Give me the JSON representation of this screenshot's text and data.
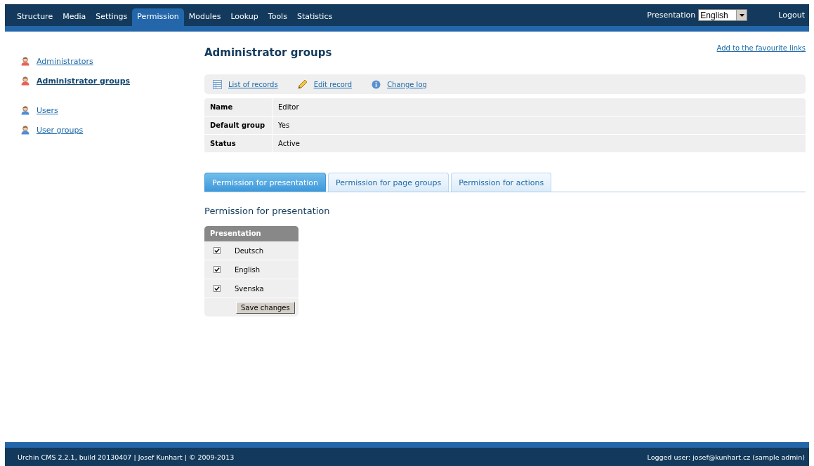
{
  "menu": [
    {
      "label": "Structure",
      "selected": false
    },
    {
      "label": "Media",
      "selected": false
    },
    {
      "label": "Settings",
      "selected": false
    },
    {
      "label": "Permission",
      "selected": true
    },
    {
      "label": "Modules",
      "selected": false
    },
    {
      "label": "Lookup",
      "selected": false
    },
    {
      "label": "Tools",
      "selected": false
    },
    {
      "label": "Statistics",
      "selected": false
    }
  ],
  "presentation": {
    "label": "Presentation",
    "value": "English"
  },
  "logout": "Logout",
  "sidebar": {
    "groups": [
      [
        {
          "label": "Administrators",
          "kind": "admin",
          "selected": false
        },
        {
          "label": "Administrator groups",
          "kind": "admin",
          "selected": true
        }
      ],
      [
        {
          "label": "Users",
          "kind": "user",
          "selected": false
        },
        {
          "label": "User groups",
          "kind": "user",
          "selected": false
        }
      ]
    ]
  },
  "title": "Administrator groups",
  "favourite": "Add to the favourite links",
  "toolbar": [
    {
      "label": "List of records",
      "kind": "list"
    },
    {
      "label": "Edit record",
      "kind": "edit"
    },
    {
      "label": "Change log",
      "kind": "info"
    }
  ],
  "details": [
    {
      "label": "Name",
      "value": "Editor"
    },
    {
      "label": "Default group",
      "value": "Yes"
    },
    {
      "label": "Status",
      "value": "Active"
    }
  ],
  "tabs": [
    {
      "label": "Permission for presentation",
      "selected": true
    },
    {
      "label": "Permission for page groups",
      "selected": false
    },
    {
      "label": "Permission for actions",
      "selected": false
    }
  ],
  "section_title": "Permission for presentation",
  "permissions": {
    "header": "Presentation",
    "rows": [
      {
        "label": "Deutsch",
        "checked": true
      },
      {
        "label": "English",
        "checked": true
      },
      {
        "label": "Svenska",
        "checked": true
      }
    ],
    "button": "Save changes"
  },
  "footer": {
    "left": "Urchin CMS 2.2.1, build 20130407 | Josef Kunhart | © 2009-2013",
    "right": "Logged user: josef@kunhart.cz (sample admin)"
  }
}
